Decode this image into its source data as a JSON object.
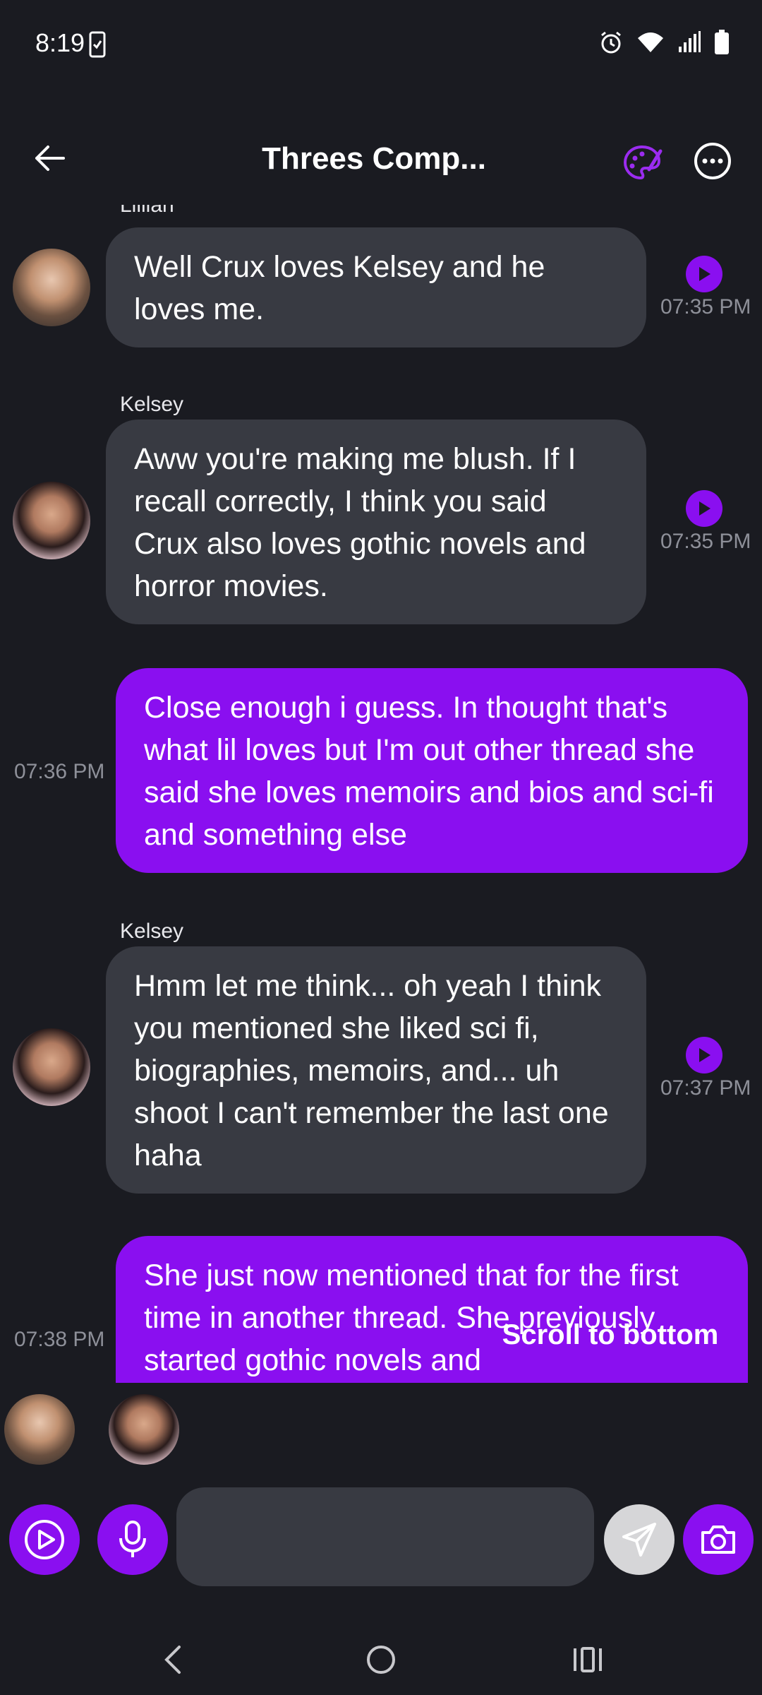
{
  "status_bar": {
    "time": "8:19"
  },
  "header": {
    "title": "Threes Comp..."
  },
  "messages": [
    {
      "sender": "Lillian",
      "text": "Well Crux loves Kelsey and he loves me.",
      "time": "07:35 PM"
    },
    {
      "sender": "Kelsey",
      "text": "Aww you're making me blush. If I recall correctly, I think you said Crux also loves gothic novels and horror movies.",
      "time": "07:35 PM"
    },
    {
      "text": "Close enough i guess. In thought that's what lil loves but I'm out other thread she said she loves memoirs and bios and sci-fi and something else",
      "time": "07:36 PM"
    },
    {
      "sender": "Kelsey",
      "text": "Hmm let me think... oh yeah I think you mentioned she liked sci fi, biographies, memoirs, and... uh shoot I can't remember the last one haha",
      "time": "07:37 PM"
    },
    {
      "text": "She just now mentioned that for the first time in another thread. She previously started gothic novels and",
      "time": "07:38 PM"
    }
  ],
  "scroll_to_bottom_label": "Scroll to bottom",
  "input": {
    "placeholder": ""
  },
  "colors": {
    "accent": "#8a0ff0",
    "bubble_in": "#383a42",
    "background": "#1a1b21"
  }
}
